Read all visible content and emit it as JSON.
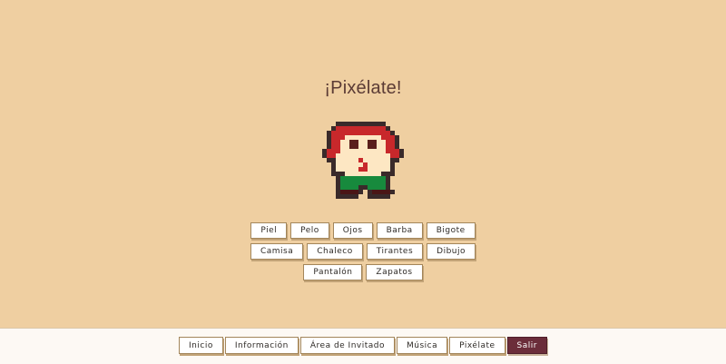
{
  "page": {
    "title": "¡Pixélate!"
  },
  "character": {
    "colors": {
      "outline": "#3a2a2a",
      "hair": "#c8282b",
      "skin": "#fde7c3",
      "eyes": "#5a1f1c",
      "shirt_detail": "#c8282b",
      "pants": "#178a3d",
      "shoes": "#4a1616"
    }
  },
  "options": {
    "row1": [
      "Piel",
      "Pelo",
      "Ojos",
      "Barba",
      "Bigote"
    ],
    "row2": [
      "Camisa",
      "Chaleco",
      "Tirantes",
      "Dibujo"
    ],
    "row3": [
      "Pantalón",
      "Zapatos"
    ]
  },
  "footer": {
    "nav": [
      "Inicio",
      "Información",
      "Área de Invitado",
      "Música",
      "Pixélate",
      "Salir"
    ],
    "active": "Salir",
    "active_color": "#6b2d3a"
  }
}
